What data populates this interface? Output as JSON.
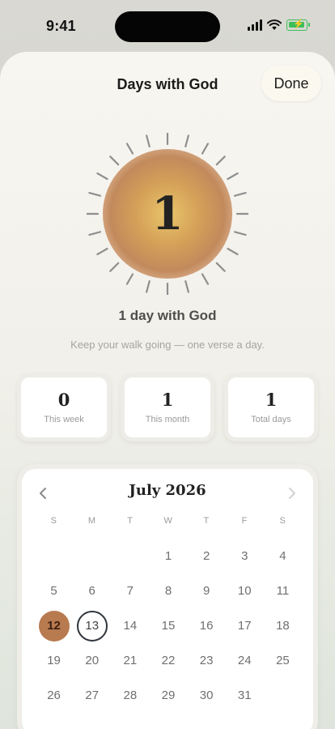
{
  "status_bar": {
    "time": "9:41"
  },
  "sheet": {
    "title": "Days with God",
    "done_label": "Done"
  },
  "streak": {
    "count": "1",
    "label": "1 day with God",
    "subtitle": "Keep your walk going — one verse a day."
  },
  "stats": [
    {
      "value": "0",
      "label": "This week"
    },
    {
      "value": "1",
      "label": "This month"
    },
    {
      "value": "1",
      "label": "Total days"
    }
  ],
  "calendar": {
    "month_label": "July 2026",
    "weekdays": [
      "S",
      "M",
      "T",
      "W",
      "T",
      "F",
      "S"
    ],
    "days": [
      {
        "day": "",
        "state": "blank"
      },
      {
        "day": "",
        "state": "blank"
      },
      {
        "day": "",
        "state": "blank"
      },
      {
        "day": "1",
        "state": "normal"
      },
      {
        "day": "2",
        "state": "normal"
      },
      {
        "day": "3",
        "state": "normal"
      },
      {
        "day": "4",
        "state": "normal"
      },
      {
        "day": "5",
        "state": "normal"
      },
      {
        "day": "6",
        "state": "normal"
      },
      {
        "day": "7",
        "state": "normal"
      },
      {
        "day": "8",
        "state": "normal"
      },
      {
        "day": "9",
        "state": "normal"
      },
      {
        "day": "10",
        "state": "normal"
      },
      {
        "day": "11",
        "state": "normal"
      },
      {
        "day": "12",
        "state": "active"
      },
      {
        "day": "13",
        "state": "today"
      },
      {
        "day": "14",
        "state": "normal"
      },
      {
        "day": "15",
        "state": "normal"
      },
      {
        "day": "16",
        "state": "normal"
      },
      {
        "day": "17",
        "state": "normal"
      },
      {
        "day": "18",
        "state": "normal"
      },
      {
        "day": "19",
        "state": "normal"
      },
      {
        "day": "20",
        "state": "normal"
      },
      {
        "day": "21",
        "state": "normal"
      },
      {
        "day": "22",
        "state": "normal"
      },
      {
        "day": "23",
        "state": "normal"
      },
      {
        "day": "24",
        "state": "normal"
      },
      {
        "day": "25",
        "state": "normal"
      },
      {
        "day": "26",
        "state": "normal"
      },
      {
        "day": "27",
        "state": "normal"
      },
      {
        "day": "28",
        "state": "normal"
      },
      {
        "day": "29",
        "state": "normal"
      },
      {
        "day": "30",
        "state": "normal"
      },
      {
        "day": "31",
        "state": "normal"
      }
    ]
  },
  "colors": {
    "active_day": "#b87a4f",
    "today_ring": "#2f343b",
    "battery": "#3cbf5a",
    "sun_center": "#e9c56a",
    "sun_edge": "#c28a5c"
  },
  "icons": {
    "prev": "chevron-left-icon",
    "next": "chevron-right-icon",
    "signal": "cellular-signal-icon",
    "wifi": "wifi-icon",
    "battery": "battery-charging-icon"
  }
}
